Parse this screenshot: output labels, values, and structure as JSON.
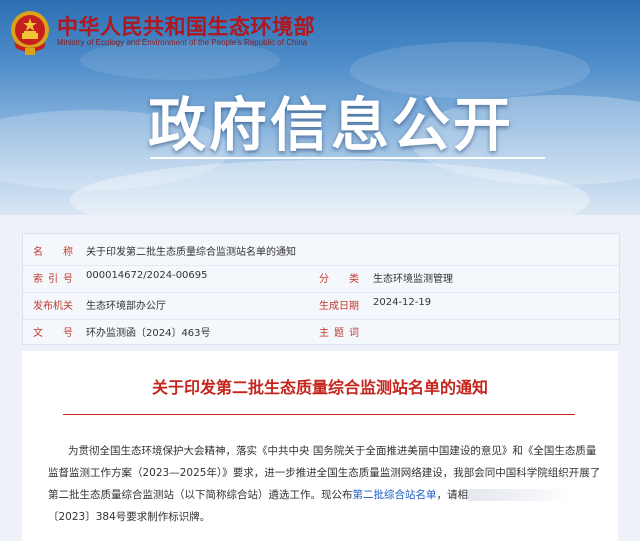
{
  "header": {
    "ministry_cn": "中华人民共和国生态环境部",
    "ministry_en": "Ministry of Ecology and Environment of the People's Republic of China",
    "banner_title": "政府信息公开"
  },
  "info": {
    "name_label": "名　　称",
    "name_value": "关于印发第二批生态质量综合监测站名单的通知",
    "index_label": "索 引 号",
    "index_value": "000014672/2024-00695",
    "category_label": "分　　类",
    "category_value": "生态环境监测管理",
    "issuer_label": "发布机关",
    "issuer_value": "生态环境部办公厅",
    "date_label": "生成日期",
    "date_value": "2024-12-19",
    "docno_label": "文　　号",
    "docno_value": "环办监测函〔2024〕463号",
    "topic_label": "主 题 词",
    "topic_value": ""
  },
  "article": {
    "title": "关于印发第二批生态质量综合监测站名单的通知",
    "line1": "为贯彻全国生态环境保护大会精神，落实《中共中央 国务院关于全面推进美丽中国建设的意见》和《全国生态质量",
    "line2": "监督监测工作方案（2023—2025年）》要求，进一步推进全国生态质量监测网络建设，我部会同中国科学院组织开展了",
    "line3_a": "第二批生态质量综合监测站（以下简称综合站）遴选工作。现公布",
    "line3_link": "第二批综合站名单",
    "line3_b": "，请相",
    "line4": "〔2023〕384号要求制作标识牌。"
  },
  "colors": {
    "ministry_red": "#b1161c",
    "label_red": "#c13a2d",
    "title_red": "#c4261d",
    "link_blue": "#1a5bc4"
  }
}
